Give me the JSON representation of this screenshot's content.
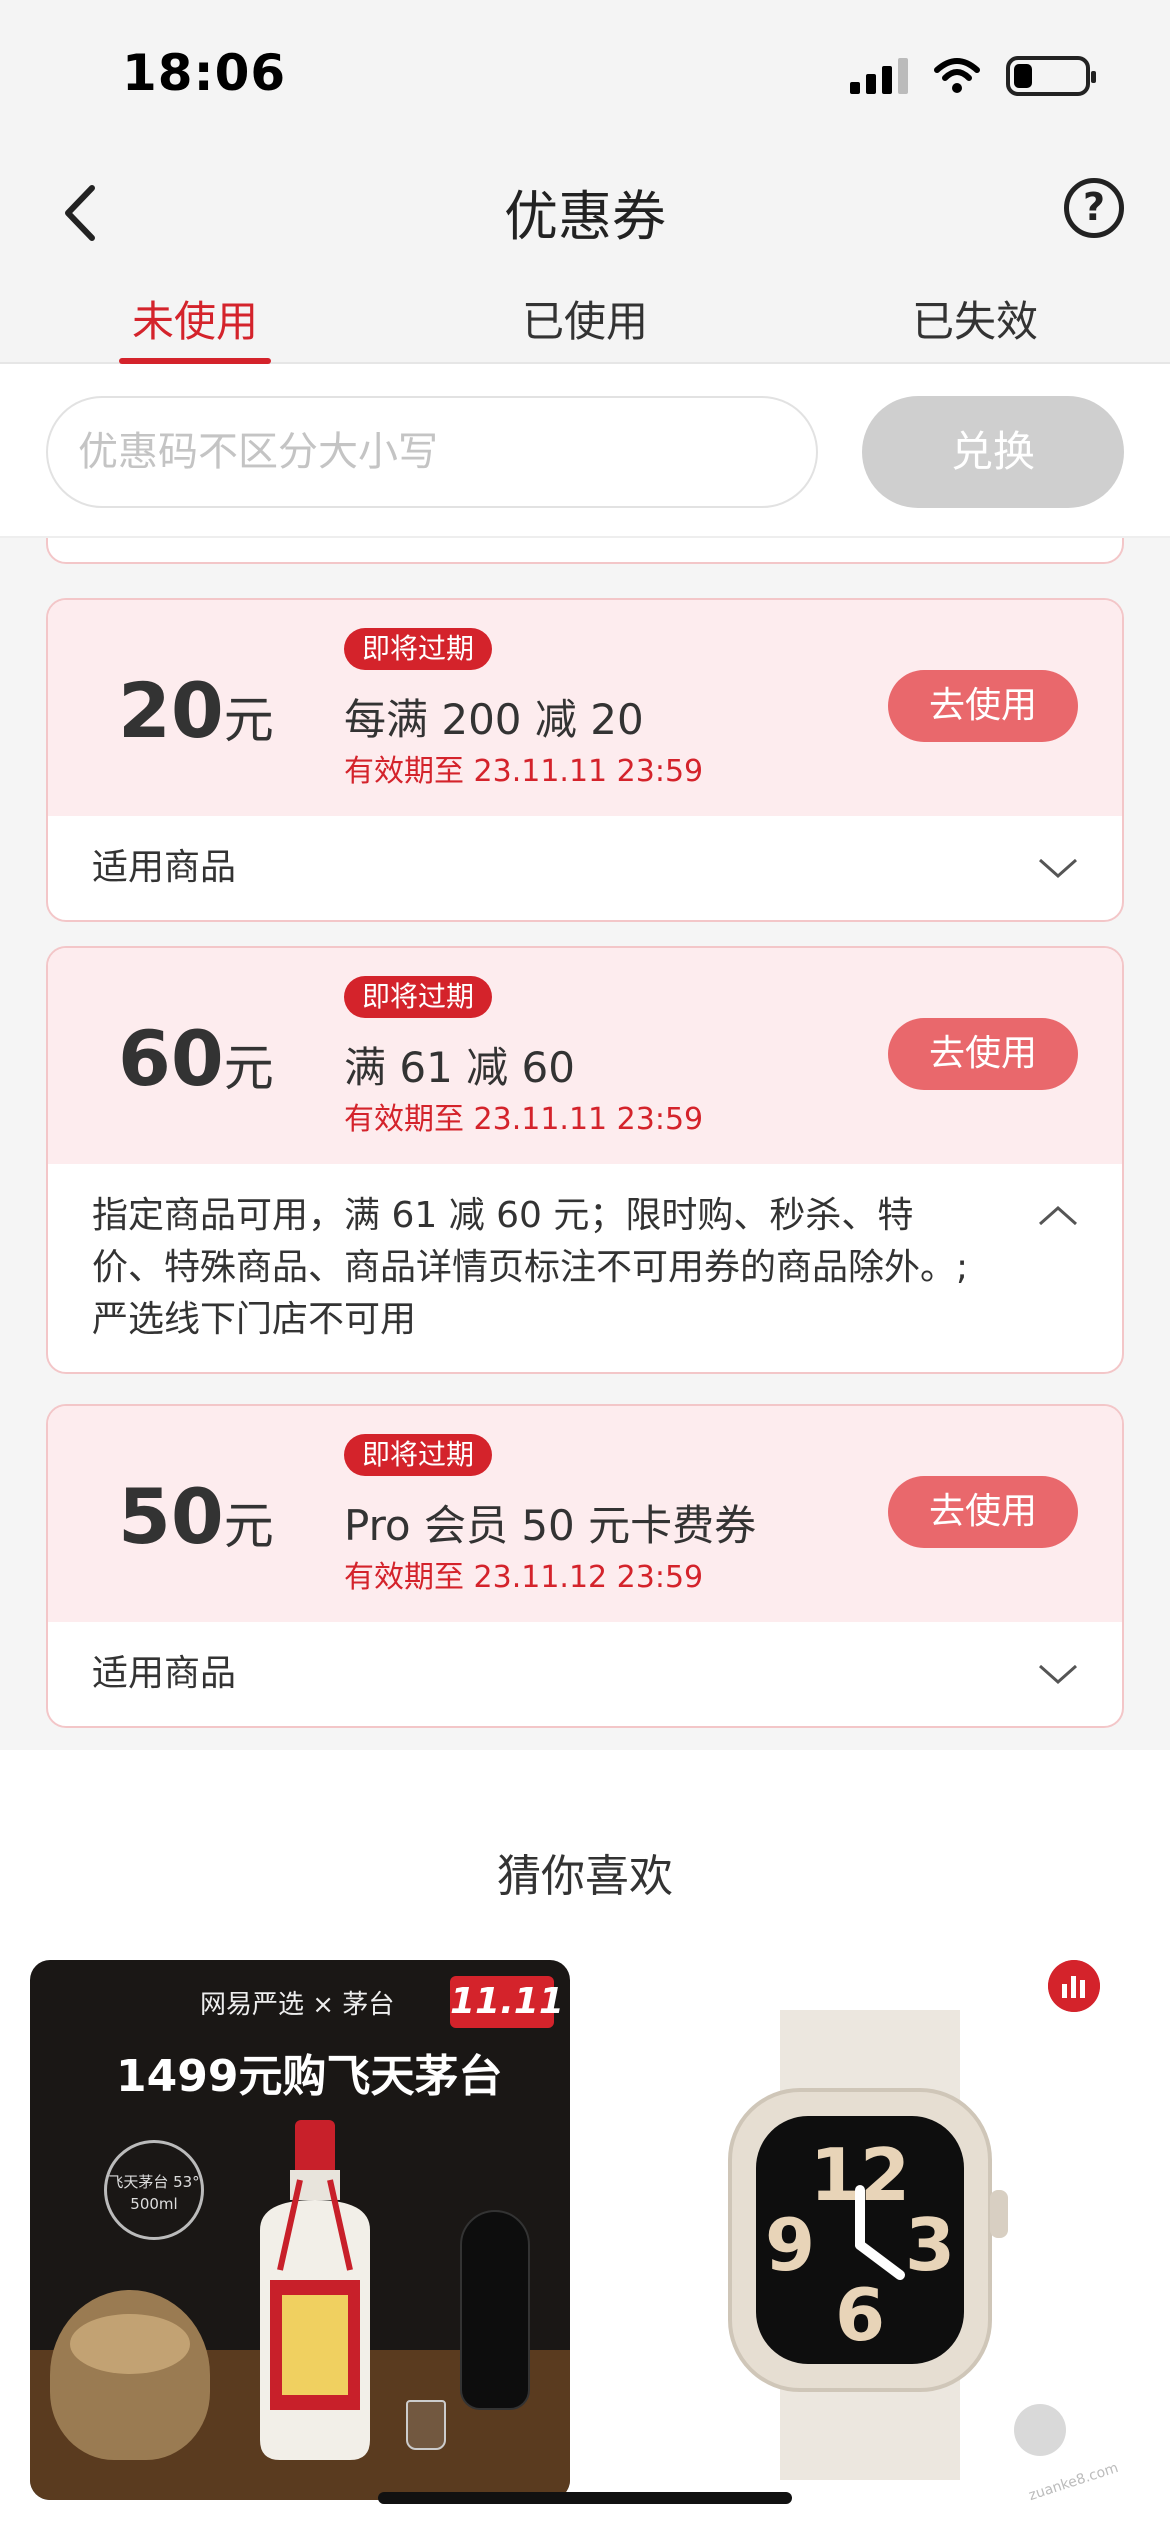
{
  "status": {
    "time": "18:06"
  },
  "nav": {
    "title": "优惠券",
    "help": "?"
  },
  "tabs": [
    "未使用",
    "已使用",
    "已失效"
  ],
  "redeem": {
    "placeholder": "优惠码不区分大小写",
    "button": "兑换"
  },
  "coupons": [
    {
      "amount": "20",
      "unit": "元",
      "tag": "即将过期",
      "desc": "每满 200 减 20",
      "expire": "有效期至 23.11.11 23:59",
      "button": "去使用",
      "footer": "适用商品",
      "expanded": false
    },
    {
      "amount": "60",
      "unit": "元",
      "tag": "即将过期",
      "desc": "满 61 减 60",
      "expire": "有效期至 23.11.11 23:59",
      "button": "去使用",
      "footer": "指定商品可用，满 61 减 60 元；限时购、秒杀、特价、特殊商品、商品详情页标注不可用券的商品除外。;严选线下门店不可用",
      "expanded": true
    },
    {
      "amount": "50",
      "unit": "元",
      "tag": "即将过期",
      "desc": "Pro 会员 50 元卡费券",
      "expire": "有效期至 23.11.12 23:59",
      "button": "去使用",
      "footer": "适用商品",
      "expanded": false
    }
  ],
  "recommend": {
    "title": "猜你喜欢",
    "product1": {
      "brand": "网易严选 × 茅台",
      "badge": "11.11",
      "headline": "1499元购飞天茅台",
      "seal": "飞天茅台 53° 500ml"
    },
    "product2": {}
  },
  "watermark": "zuanke8.com"
}
